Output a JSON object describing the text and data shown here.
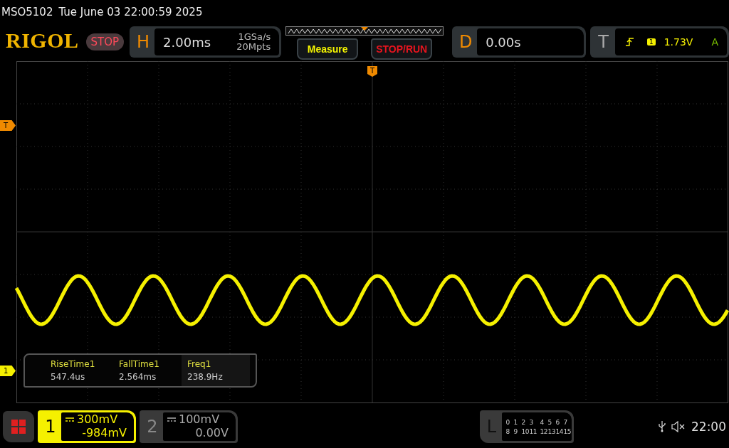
{
  "header": {
    "model": "MSO5102",
    "datetime": "Tue June 03 22:00:59 2025"
  },
  "brand": "RIGOL",
  "run_state": "STOP",
  "horizontal": {
    "label": "H",
    "timebase": "2.00ms",
    "sample_rate": "1GSa/s",
    "memory_depth": "20Mpts"
  },
  "buttons": [
    {
      "label": "Measure",
      "kind": "measure"
    },
    {
      "label": "STOP/RUN",
      "kind": "stoprun"
    }
  ],
  "delay": {
    "label": "D",
    "value": "0.00s"
  },
  "trigger": {
    "label": "T",
    "source": "1",
    "level": "1.73V",
    "mode": "A"
  },
  "markers": {
    "trigger_position": "T",
    "trigger_level": "T",
    "channel": "1"
  },
  "measurements": [
    {
      "name": "RiseTime1",
      "value": "547.4us",
      "selected": false
    },
    {
      "name": "FallTime1",
      "value": "2.564ms",
      "selected": false
    },
    {
      "name": "Freq1",
      "value": "238.9Hz",
      "selected": true
    }
  ],
  "channels": [
    {
      "number": "1",
      "scale": "300mV",
      "offset": "-984mV",
      "active": true
    },
    {
      "number": "2",
      "scale": "100mV",
      "offset": "0.00V",
      "active": false
    }
  ],
  "logic": {
    "label": "L",
    "rows": [
      [
        "0",
        "1",
        "2",
        "3",
        "4",
        "5",
        "6",
        "7"
      ],
      [
        "8",
        "9",
        "10",
        "11",
        "12",
        "13",
        "14",
        "15"
      ]
    ]
  },
  "tray": {
    "time": "22:00",
    "muted": true
  }
}
